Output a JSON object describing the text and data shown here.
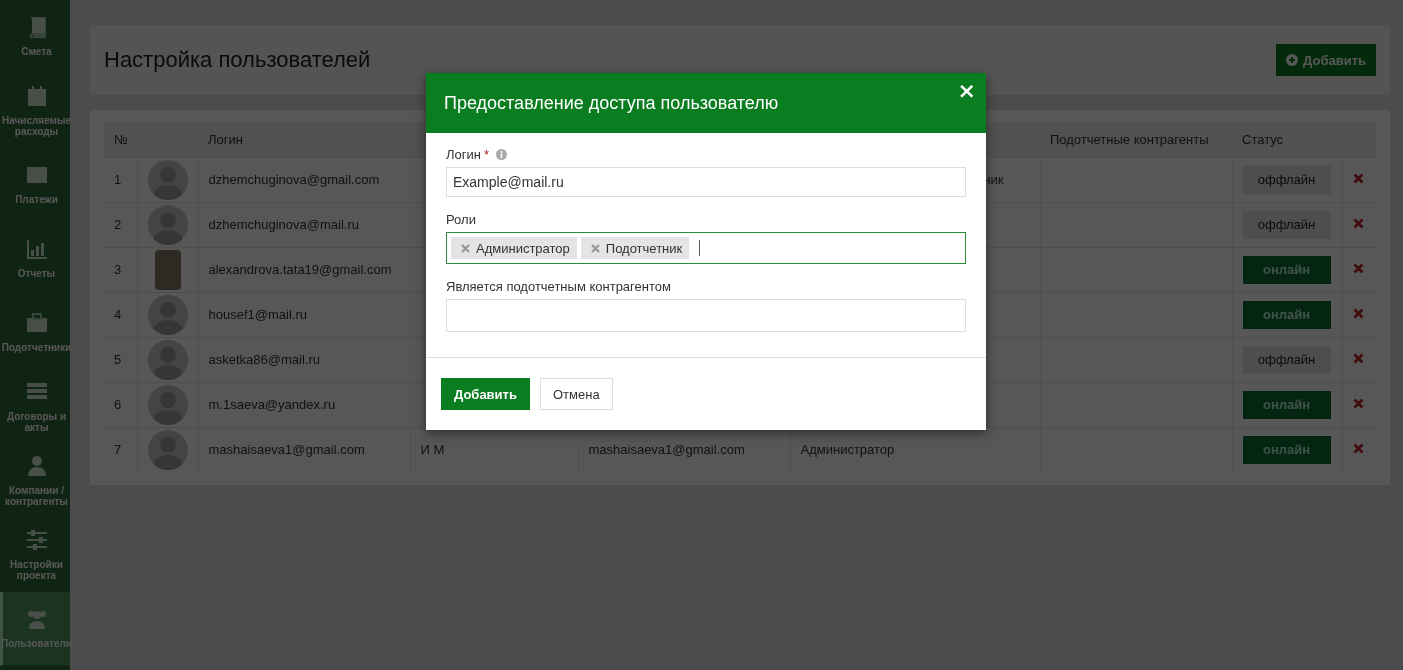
{
  "sidebar": {
    "items": [
      {
        "label": "Смета",
        "selected": false
      },
      {
        "label": "Начисляемые расходы",
        "selected": false
      },
      {
        "label": "Платежи",
        "selected": false
      },
      {
        "label": "Отчеты",
        "selected": false
      },
      {
        "label": "Подотчетники",
        "selected": false
      },
      {
        "label": "Договоры и акты",
        "selected": false
      },
      {
        "label": "Компании / контрагенты",
        "selected": false
      },
      {
        "label": "Настройки проекта",
        "selected": false
      },
      {
        "label": "Пользователи",
        "selected": true
      }
    ]
  },
  "page": {
    "title": "Настройка пользователей",
    "add_button": "Добавить"
  },
  "table": {
    "columns": [
      {
        "label": "№"
      },
      {},
      {
        "label": "Логин"
      },
      {},
      {},
      {},
      {
        "label": "Подотчетные контрагенты"
      },
      {
        "label": "Статус"
      },
      {}
    ],
    "rows": [
      {
        "number": "1",
        "has_photo": false,
        "login": "dzhemchuginova@gmail.com",
        "column_6": "ник",
        "column_6_cut": true,
        "online": false,
        "status": "оффлайн"
      },
      {
        "number": "2",
        "has_photo": false,
        "login": "dzhemchuginova@mail.ru",
        "online": false,
        "status": "оффлайн"
      },
      {
        "number": "3",
        "has_photo": true,
        "login": "alexandrova.tata19@gmail.com",
        "online": true,
        "status": "онлайн"
      },
      {
        "number": "4",
        "has_photo": false,
        "login": "housef1@mail.ru",
        "online": true,
        "status": "онлайн"
      },
      {
        "number": "5",
        "has_photo": false,
        "login": "asketka86@mail.ru",
        "online": false,
        "status": "оффлайн"
      },
      {
        "number": "6",
        "has_photo": false,
        "login": "m.1saeva@yandex.ru",
        "online": true,
        "status": "онлайн"
      },
      {
        "number": "7",
        "has_photo": false,
        "login": "mashaisaeva1@gmail.com",
        "column_4": "И М",
        "column_5": "mashaisaeva1@gmail.com",
        "column_6": "Администратор",
        "online": true,
        "status": "онлайн"
      }
    ]
  },
  "dialog": {
    "title": "Предоставление доступа пользователю",
    "close": "×",
    "login": {
      "label": "Логин",
      "required_mark": "*",
      "value": "Example@mail.ru"
    },
    "roles": {
      "label": "Роли",
      "focused": true,
      "tags": [
        "Администратор",
        "Подотчетник"
      ]
    },
    "contractor": {
      "label": "Является подотчетным контрагентом"
    },
    "buttons": [
      {
        "label": "Добавить",
        "primary": true
      },
      {
        "label": "Отмена",
        "primary": false
      }
    ]
  }
}
